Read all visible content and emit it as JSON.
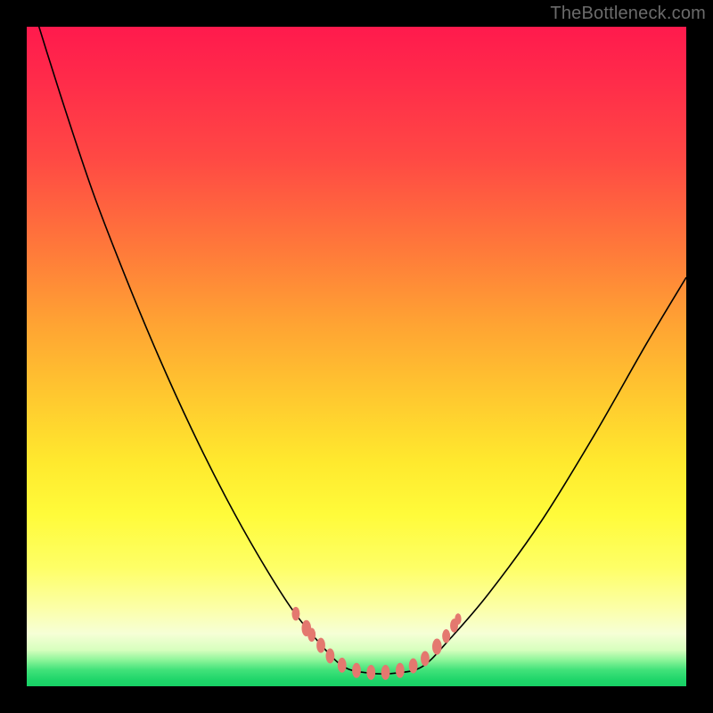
{
  "watermark": "TheBottleneck.com",
  "colors": {
    "frame": "#000000",
    "gradient_top": "#ff1a4d",
    "gradient_mid": "#ffe92e",
    "gradient_bottom": "#17d065",
    "curve": "#000000",
    "dots": "#e4786f"
  },
  "chart_data": {
    "type": "line",
    "title": "",
    "xlabel": "",
    "ylabel": "",
    "xlim": [
      0,
      100
    ],
    "ylim": [
      0,
      100
    ],
    "note": "The image shows a V-shaped bottleneck curve (lower is better) with a flat minimum around x≈48–60. Values below are estimated from pixel positions; y measured from the top so 0≈top (worst/red), 100≈bottom (best/green).",
    "series": [
      {
        "name": "bottleneck-curve",
        "x": [
          0,
          5,
          10,
          15,
          20,
          25,
          30,
          35,
          40,
          44,
          48,
          52,
          56,
          60,
          64,
          70,
          78,
          86,
          94,
          100
        ],
        "y": [
          -6,
          10,
          25,
          38,
          50,
          61,
          71,
          80,
          88,
          93,
          97,
          98,
          98,
          97,
          93,
          86,
          75,
          62,
          48,
          38
        ]
      }
    ],
    "markers": {
      "name": "highlight-dots",
      "points": [
        {
          "x": 40.8,
          "y": 89.0,
          "r": 1.1
        },
        {
          "x": 42.4,
          "y": 91.2,
          "r": 1.3
        },
        {
          "x": 43.2,
          "y": 92.2,
          "r": 1.1
        },
        {
          "x": 44.6,
          "y": 93.8,
          "r": 1.2
        },
        {
          "x": 46.0,
          "y": 95.4,
          "r": 1.2
        },
        {
          "x": 47.8,
          "y": 96.8,
          "r": 1.2
        },
        {
          "x": 50.0,
          "y": 97.6,
          "r": 1.2
        },
        {
          "x": 52.2,
          "y": 97.9,
          "r": 1.2
        },
        {
          "x": 54.4,
          "y": 97.9,
          "r": 1.2
        },
        {
          "x": 56.6,
          "y": 97.6,
          "r": 1.2
        },
        {
          "x": 58.6,
          "y": 96.9,
          "r": 1.2
        },
        {
          "x": 60.4,
          "y": 95.8,
          "r": 1.2
        },
        {
          "x": 62.2,
          "y": 94.0,
          "r": 1.3
        },
        {
          "x": 63.6,
          "y": 92.4,
          "r": 1.1
        },
        {
          "x": 64.8,
          "y": 90.8,
          "r": 1.1
        },
        {
          "x": 65.4,
          "y": 89.8,
          "r": 0.9
        }
      ]
    }
  }
}
